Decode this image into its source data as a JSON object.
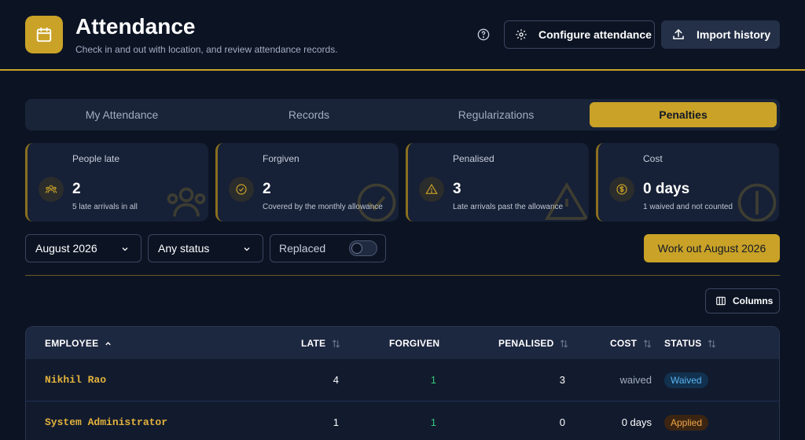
{
  "header": {
    "title": "Attendance",
    "subtitle": "Check in and out with location, and review attendance records.",
    "configure_label": "Configure attendance",
    "import_label": "Import history"
  },
  "tabs": [
    {
      "label": "My Attendance",
      "active": false
    },
    {
      "label": "Records",
      "active": false
    },
    {
      "label": "Regularizations",
      "active": false
    },
    {
      "label": "Penalties",
      "active": true
    }
  ],
  "cards": [
    {
      "label": "People late",
      "value": "2",
      "note": "5 late arrivals in all",
      "icon": "people-icon"
    },
    {
      "label": "Forgiven",
      "value": "2",
      "note": "Covered by the monthly allowance",
      "icon": "check-circle-icon"
    },
    {
      "label": "Penalised",
      "value": "3",
      "note": "Late arrivals past the allowance",
      "icon": "warning-icon"
    },
    {
      "label": "Cost",
      "value": "0 days",
      "note": "1 waived and not counted",
      "icon": "dollar-icon"
    }
  ],
  "filters": {
    "month": "August 2026",
    "status": "Any status",
    "replaced_label": "Replaced",
    "replaced_on": false,
    "work_out_label": "Work out August 2026"
  },
  "columns_label": "Columns",
  "table": {
    "headers": [
      "EMPLOYEE",
      "LATE",
      "FORGIVEN",
      "PENALISED",
      "COST",
      "STATUS"
    ],
    "rows": [
      {
        "employee": "Nikhil Rao",
        "late": "4",
        "forgiven": "1",
        "penalised": "3",
        "cost": "waived",
        "status": "Waived"
      },
      {
        "employee": "System Administrator",
        "late": "1",
        "forgiven": "1",
        "penalised": "0",
        "cost": "0 days",
        "status": "Applied"
      }
    ]
  },
  "colors": {
    "accent": "#c9a227",
    "background": "#0c1424",
    "forgiven_green": "#34c77b",
    "waived_blue": "#5ab4ef",
    "applied_orange": "#f0a64a"
  }
}
